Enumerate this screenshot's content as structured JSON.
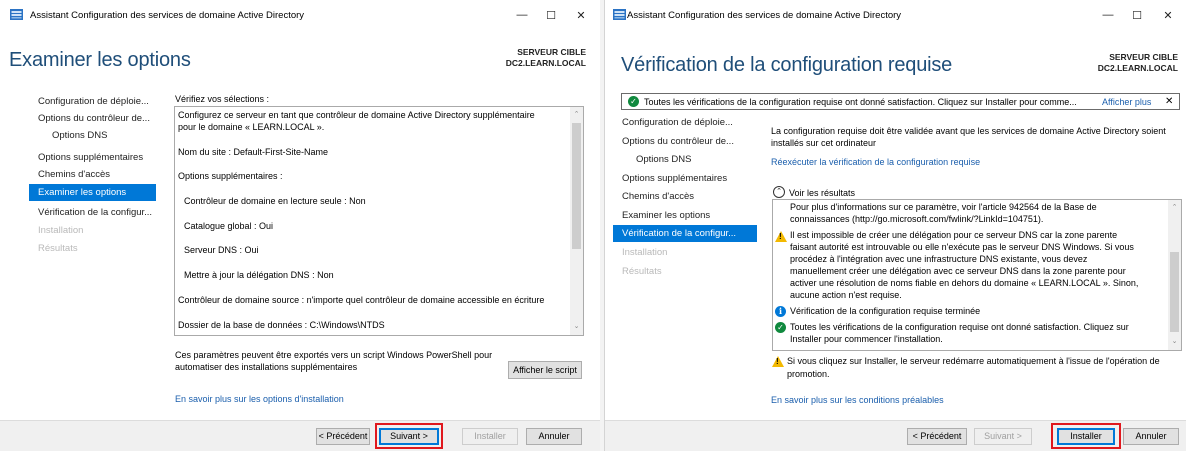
{
  "left": {
    "title": "Assistant Configuration des services de domaine Active Directory",
    "heading": "Examiner les options",
    "target_label": "SERVEUR CIBLE",
    "target_server": "DC2.LEARN.LOCAL",
    "nav": [
      {
        "label": "Configuration de déploie...",
        "state": "normal"
      },
      {
        "label": "Options du contrôleur de...",
        "state": "normal"
      },
      {
        "label": "Options DNS",
        "state": "sub"
      },
      {
        "label": "Options supplémentaires",
        "state": "normal"
      },
      {
        "label": "Chemins d'accès",
        "state": "normal"
      },
      {
        "label": "Examiner les options",
        "state": "selected"
      },
      {
        "label": "Vérification de la configur...",
        "state": "normal"
      },
      {
        "label": "Installation",
        "state": "disabled"
      },
      {
        "label": "Résultats",
        "state": "disabled"
      }
    ],
    "review_label": "Vérifiez vos sélections :",
    "review_lines": [
      "Configurez ce serveur en tant que contrôleur de domaine Active Directory supplémentaire",
      "pour le domaine « LEARN.LOCAL ».",
      "Nom du site : Default-First-Site-Name",
      "Options supplémentaires :",
      "  Contrôleur de domaine en lecture seule : Non",
      "  Catalogue global : Oui",
      "  Serveur DNS : Oui",
      "  Mettre à jour la délégation DNS : Non",
      "Contrôleur de domaine source : n'importe quel contrôleur de domaine accessible en écriture",
      "Dossier de la base de données : C:\\Windows\\NTDS"
    ],
    "export_text_1": "Ces paramètres peuvent être exportés vers un script Windows PowerShell pour",
    "export_text_2": "automatiser des installations supplémentaires",
    "view_script_button": "Afficher le script",
    "more_link": "En savoir plus sur les options d'installation",
    "buttons": {
      "prev": "< Précédent",
      "next": "Suivant >",
      "install": "Installer",
      "cancel": "Annuler"
    }
  },
  "right": {
    "title": "Assistant Configuration des services de domaine Active Directory",
    "heading": "Vérification de la configuration requise",
    "target_label": "SERVEUR CIBLE",
    "target_server": "DC2.LEARN.LOCAL",
    "banner_text": "Toutes les vérifications de la configuration requise ont donné satisfaction. Cliquez sur Installer pour comme...",
    "banner_link": "Afficher plus",
    "nav": [
      {
        "label": "Configuration de déploie...",
        "state": "normal"
      },
      {
        "label": "Options du contrôleur de...",
        "state": "normal"
      },
      {
        "label": "Options DNS",
        "state": "sub"
      },
      {
        "label": "Options supplémentaires",
        "state": "normal"
      },
      {
        "label": "Chemins d'accès",
        "state": "normal"
      },
      {
        "label": "Examiner les options",
        "state": "normal"
      },
      {
        "label": "Vérification de la configur...",
        "state": "selected"
      },
      {
        "label": "Installation",
        "state": "disabled"
      },
      {
        "label": "Résultats",
        "state": "disabled"
      }
    ],
    "intro_1": "La configuration requise doit être validée avant que les services de domaine Active Directory soient",
    "intro_2": "installés sur cet ordinateur",
    "rerun_link": "Réexécuter la vérification de la configuration requise",
    "results_label": "Voir les résultats",
    "results": {
      "info1_1": "Pour plus d'informations sur ce paramètre, voir l'article 942564 de la Base de",
      "info1_2": "connaissances (http://go.microsoft.com/fwlink/?LinkId=104751).",
      "warn_lines": [
        "Il est impossible de créer une délégation pour ce serveur DNS car la zone parente",
        "faisant autorité est introuvable ou elle n'exécute pas le serveur DNS Windows. Si vous",
        "procédez à l'intégration avec une infrastructure DNS existante, vous devez",
        "manuellement créer une délégation avec ce serveur DNS dans la zone parente pour",
        "activer une résolution de noms fiable en dehors du domaine « LEARN.LOCAL ». Sinon,",
        "aucune action n'est requise."
      ],
      "done": "Vérification de la configuration requise terminée",
      "ok_1": "Toutes les vérifications de la configuration requise ont donné satisfaction. Cliquez sur",
      "ok_2": "Installer pour commencer l'installation."
    },
    "restart_1": "Si vous cliquez sur Installer, le serveur redémarre automatiquement à l'issue de l'opération de",
    "restart_2": "promotion.",
    "more_link": "En savoir plus sur les conditions préalables",
    "buttons": {
      "prev": "< Précédent",
      "next": "Suivant >",
      "install": "Installer",
      "cancel": "Annuler"
    }
  }
}
